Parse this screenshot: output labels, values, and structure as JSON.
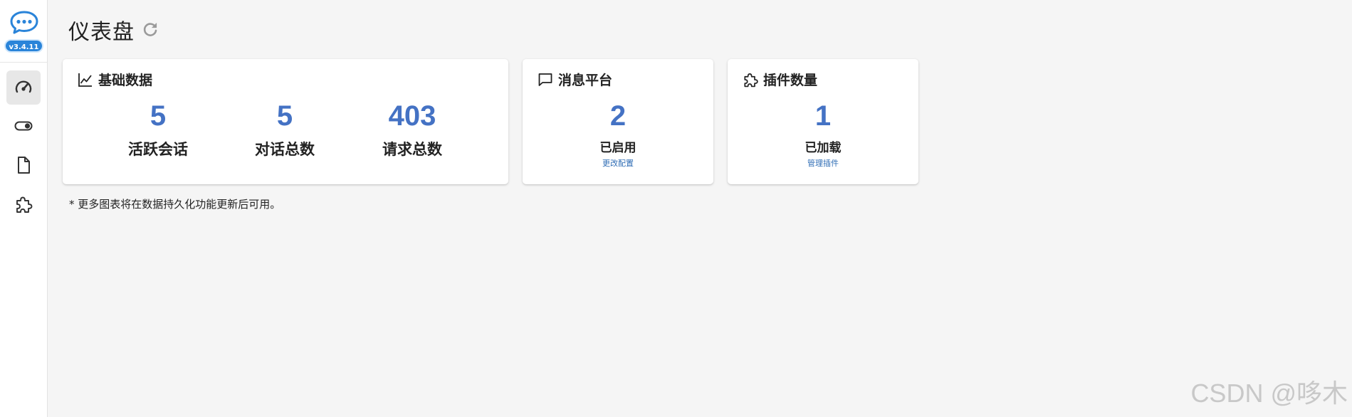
{
  "app": {
    "version": "v3.4.11"
  },
  "sidebar": {
    "items": [
      {
        "name": "dashboard",
        "icon": "speedometer-icon",
        "active": true
      },
      {
        "name": "toggle",
        "icon": "toggle-switch-icon",
        "active": false
      },
      {
        "name": "document",
        "icon": "file-icon",
        "active": false
      },
      {
        "name": "plugins",
        "icon": "puzzle-icon",
        "active": false
      }
    ]
  },
  "header": {
    "title": "仪表盘",
    "refresh_icon": "refresh-icon"
  },
  "cards": {
    "basic": {
      "title": "基础数据",
      "icon": "line-chart-icon",
      "stats": [
        {
          "value": "5",
          "label": "活跃会话"
        },
        {
          "value": "5",
          "label": "对话总数"
        },
        {
          "value": "403",
          "label": "请求总数"
        }
      ]
    },
    "platform": {
      "title": "消息平台",
      "icon": "chat-bubble-icon",
      "value": "2",
      "label": "已启用",
      "link": "更改配置"
    },
    "plugins": {
      "title": "插件数量",
      "icon": "puzzle-icon",
      "value": "1",
      "label": "已加载",
      "link": "管理插件"
    }
  },
  "footnote": "* 更多图表将在数据持久化功能更新后可用。",
  "watermark": "CSDN @哆木",
  "colors": {
    "accent": "#4472c4",
    "badge": "#2a84d9",
    "background": "#f5f5f5"
  }
}
